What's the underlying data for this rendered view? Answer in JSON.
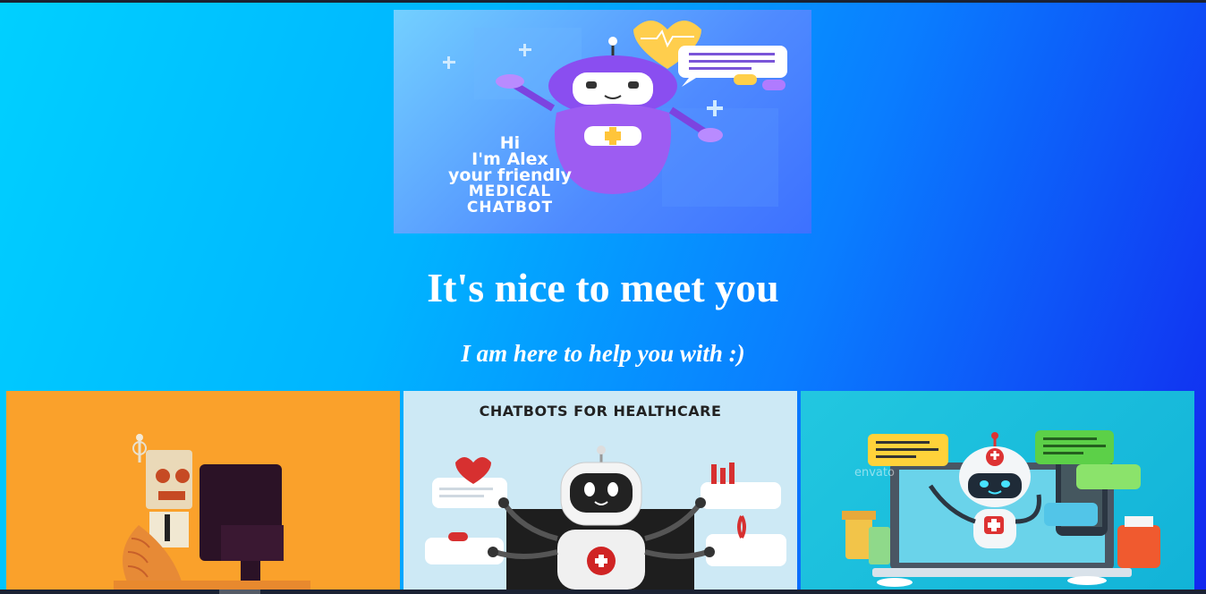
{
  "hero": {
    "line1": "Hi",
    "line2": "I'm Alex",
    "line3": "your friendly",
    "line4": "MEDICAL",
    "line5": "CHATBOT"
  },
  "heading": "It's nice to meet you",
  "subheading": "I am here to help you with :)",
  "cards": [
    {
      "title": ""
    },
    {
      "title": "CHATBOTS  FOR HEALTHCARE"
    },
    {
      "title": ""
    }
  ],
  "card3_watermark": "envato",
  "colors": {
    "card1_bg": "#faa12b",
    "card2_bg": "#cde9f5",
    "card3_bg": "#22c7e0"
  }
}
